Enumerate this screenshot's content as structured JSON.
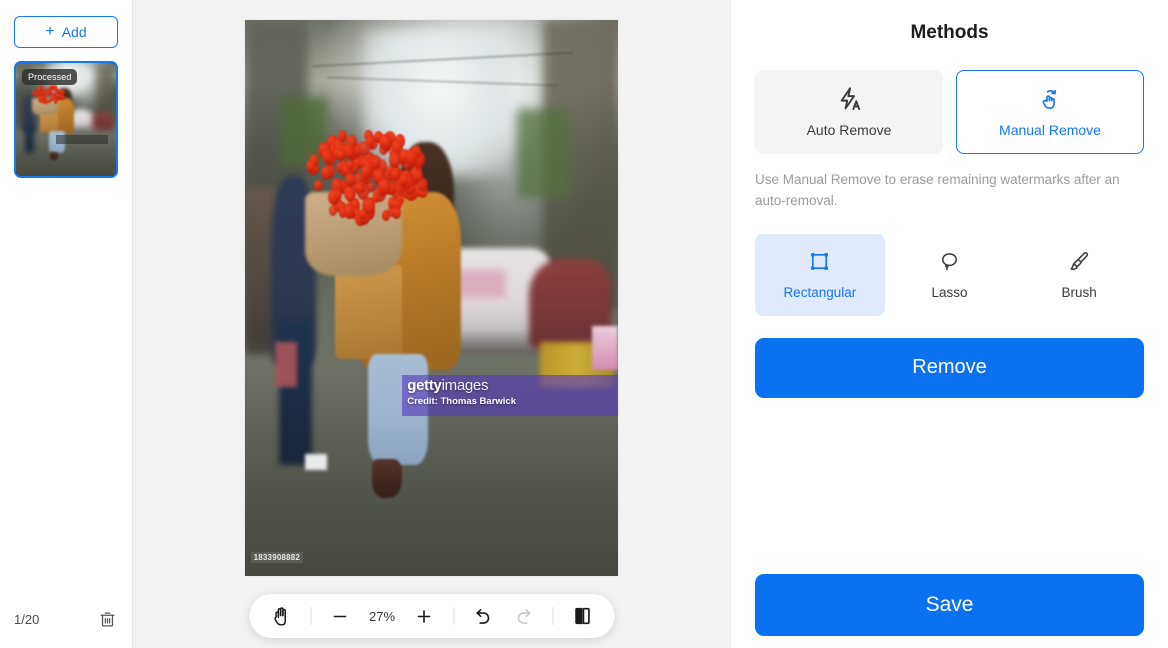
{
  "sidebar": {
    "add_label": "Add",
    "add_icon": "plus-icon",
    "thumbnails": [
      {
        "badge": "Processed",
        "selected": true
      }
    ],
    "page_count": "1/20",
    "delete_icon": "trash-icon"
  },
  "canvas": {
    "image": {
      "watermark_brand_bold": "getty",
      "watermark_brand_light": "images",
      "watermark_credit": "Credit: Thomas Barwick",
      "image_id": "1833908882",
      "selection_overlay_color": "#563abc"
    },
    "toolbar": {
      "pan_icon": "hand-icon",
      "zoom_out_icon": "minus-icon",
      "zoom_level": "27%",
      "zoom_in_icon": "plus-icon",
      "undo_icon": "undo-icon",
      "redo_icon": "redo-icon",
      "redo_disabled": true,
      "compare_icon": "compare-split-icon"
    }
  },
  "panel": {
    "title": "Methods",
    "methods": [
      {
        "label": "Auto Remove",
        "icon": "auto-flash-icon",
        "active": false
      },
      {
        "label": "Manual Remove",
        "icon": "hand-gesture-icon",
        "active": true
      }
    ],
    "hint": "Use Manual Remove to erase remaining watermarks after an auto-removal.",
    "tools": [
      {
        "label": "Rectangular",
        "icon": "rectangle-select-icon",
        "active": true
      },
      {
        "label": "Lasso",
        "icon": "lasso-icon",
        "active": false
      },
      {
        "label": "Brush",
        "icon": "brush-icon",
        "active": false
      }
    ],
    "remove_label": "Remove",
    "save_label": "Save",
    "accent_color": "#0a72f0",
    "active_tool_bg": "#dfeafd"
  }
}
